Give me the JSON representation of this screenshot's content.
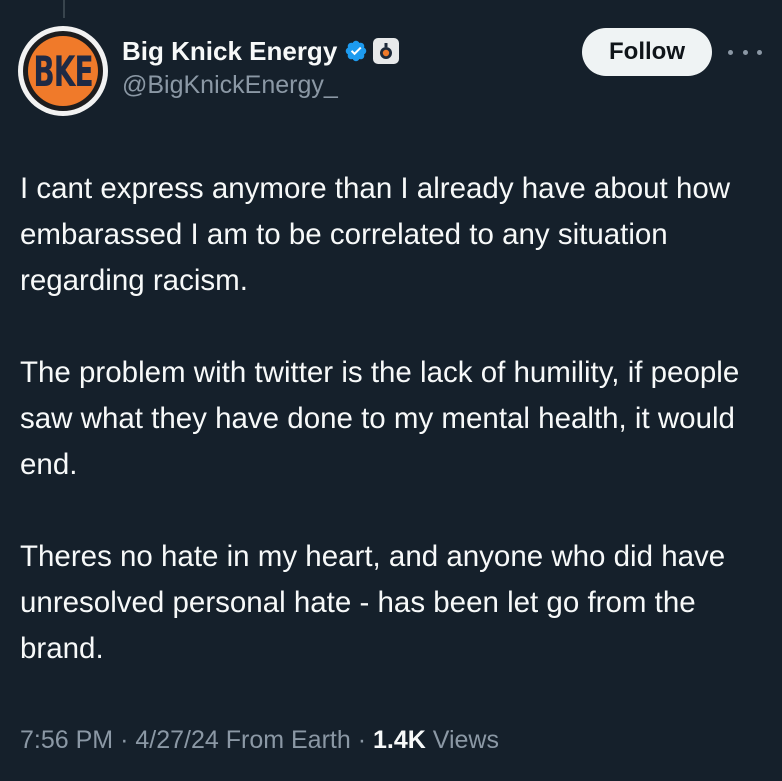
{
  "author": {
    "display_name": "Big Knick Energy",
    "handle": "@BigKnickEnergy_",
    "avatar_text": "BKE",
    "verified_icon": "verified-badge-icon",
    "affiliate_icon": "affiliate-badge-icon"
  },
  "actions": {
    "follow_label": "Follow",
    "more_icon": "more-options-icon"
  },
  "tweet": {
    "paragraphs": [
      "I cant express anymore than I already have about how embarassed I am to be correlated to any situation regarding racism.",
      "The problem with twitter is the lack of humility, if people saw what they have done to my mental health, it would end.",
      "Theres no hate in my heart, and anyone who did have unresolved personal hate - has been let go from the brand."
    ]
  },
  "meta": {
    "time": "7:56 PM",
    "date": "4/27/24",
    "source": "From Earth",
    "views_count": "1.4K",
    "views_label": "Views",
    "separator": "·"
  },
  "colors": {
    "background": "#15202b",
    "text": "#f7f9f9",
    "secondary_text": "#8b98a5",
    "verified_blue": "#1d9bf0",
    "avatar_orange": "#f07a2a",
    "follow_bg": "#eff3f4"
  }
}
